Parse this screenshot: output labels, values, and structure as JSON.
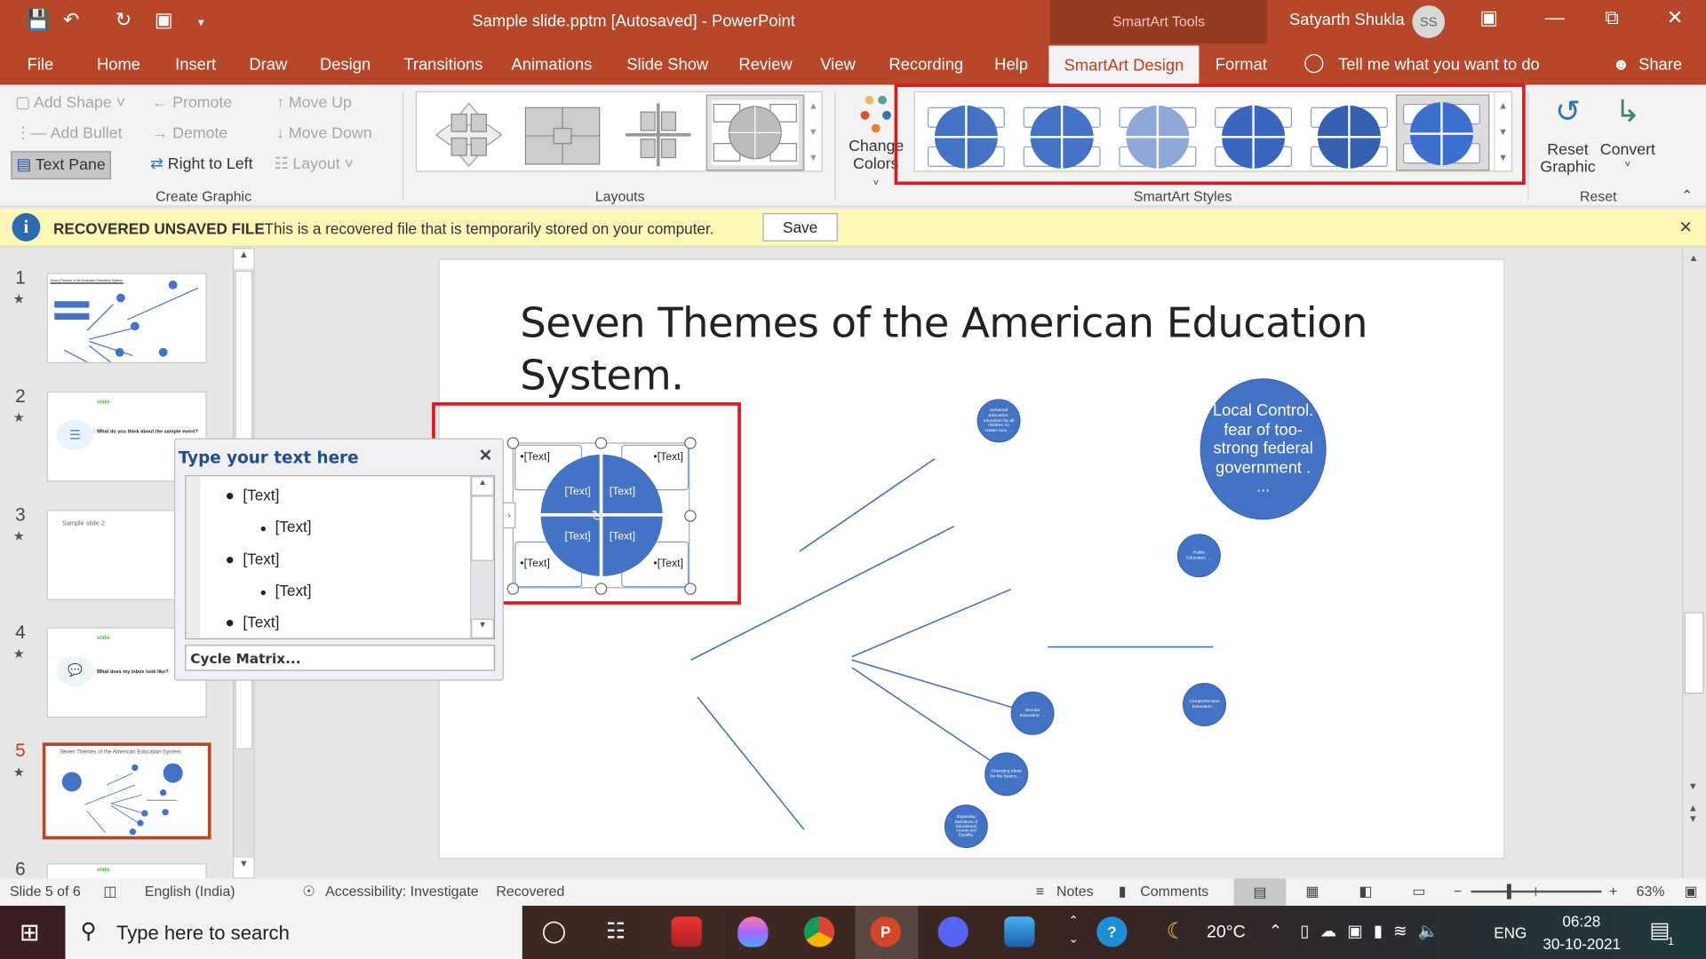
{
  "window": {
    "title": "Sample slide.pptm [Autosaved]  -  PowerPoint",
    "contextual_tab_group": "SmartArt Tools",
    "user_name": "Satyarth Shukla",
    "user_initials": "SS",
    "accent": "#b7472a"
  },
  "quick_access": [
    "save-icon",
    "undo-icon",
    "redo-icon",
    "present-icon",
    "customize-icon"
  ],
  "tabs": [
    {
      "label": "File"
    },
    {
      "label": "Home"
    },
    {
      "label": "Insert"
    },
    {
      "label": "Draw"
    },
    {
      "label": "Design"
    },
    {
      "label": "Transitions"
    },
    {
      "label": "Animations"
    },
    {
      "label": "Slide Show"
    },
    {
      "label": "Review"
    },
    {
      "label": "View"
    },
    {
      "label": "Recording"
    },
    {
      "label": "Help"
    },
    {
      "label": "SmartArt Design",
      "active": true
    },
    {
      "label": "Format"
    }
  ],
  "tell_me": "Tell me what you want to do",
  "share": "Share",
  "ribbon": {
    "create_graphic": {
      "label": "Create Graphic",
      "add_shape": "Add Shape",
      "add_bullet": "Add Bullet",
      "text_pane": "Text Pane",
      "promote": "Promote",
      "demote": "Demote",
      "right_to_left": "Right to Left",
      "move_up": "Move Up",
      "move_down": "Move Down",
      "layout": "Layout"
    },
    "layouts": {
      "label": "Layouts",
      "count_visible": 4,
      "selected_index": 3
    },
    "change_colors": {
      "line1": "Change",
      "line2": "Colors"
    },
    "smartart_styles": {
      "label": "SmartArt Styles",
      "count_visible": 6,
      "selected_index": 5
    },
    "reset": {
      "label": "Reset",
      "reset_graphic_1": "Reset",
      "reset_graphic_2": "Graphic",
      "convert": "Convert"
    }
  },
  "infobar": {
    "title": "RECOVERED UNSAVED FILE",
    "message": "This is a recovered file that is temporarily stored on your computer.",
    "save": "Save"
  },
  "thumbnails": [
    {
      "num": "1",
      "title": "Seven Themes of the American Education System."
    },
    {
      "num": "2",
      "brand": "slido",
      "text": "What do you think about the sample event?"
    },
    {
      "num": "3",
      "text": "Sample slide 2"
    },
    {
      "num": "4",
      "brand": "slido",
      "text": "What does my inbox look like?"
    },
    {
      "num": "5",
      "title": "Seven Themes of the American Education System.",
      "active": true
    },
    {
      "num": "6",
      "brand": "slido"
    }
  ],
  "slide": {
    "title": "Seven Themes of the American Education System.",
    "smartart": {
      "cells": [
        "[Text]",
        "[Text]",
        "[Text]",
        "[Text]"
      ],
      "boxes": [
        "•[Text]",
        "•[Text]",
        "•[Text]",
        "•[Text]"
      ]
    },
    "circles": [
      {
        "text": "Universal Education. education for all children no matter race. ..."
      },
      {
        "text": "Local Control. fear of too-strong federal government . ..."
      },
      {
        "text": "Public Education. . ."
      },
      {
        "text": "Secular Education. . ."
      },
      {
        "text": "Comprehensive Education. .."
      },
      {
        "text": "Changing Ideas for the Basics. ..."
      },
      {
        "text": "Expanding Definitions of Educational Access and Equality."
      }
    ]
  },
  "text_pane": {
    "title": "Type your text here",
    "items": [
      {
        "text": "[Text]",
        "level": 1
      },
      {
        "text": "[Text]",
        "level": 2
      },
      {
        "text": "[Text]",
        "level": 1
      },
      {
        "text": "[Text]",
        "level": 2
      },
      {
        "text": "[Text]",
        "level": 1
      }
    ],
    "footer": "Cycle Matrix..."
  },
  "statusbar": {
    "slide": "Slide 5 of 6",
    "language": "English (India)",
    "accessibility": "Accessibility: Investigate",
    "status": "Recovered",
    "notes": "Notes",
    "comments": "Comments",
    "zoom": "63%",
    "zoom_percent": 63
  },
  "taskbar": {
    "search_placeholder": "Type here to search",
    "weather": "20°C",
    "lang": "ENG",
    "time": "06:28",
    "date": "30-10-2021",
    "notifications": "1"
  }
}
